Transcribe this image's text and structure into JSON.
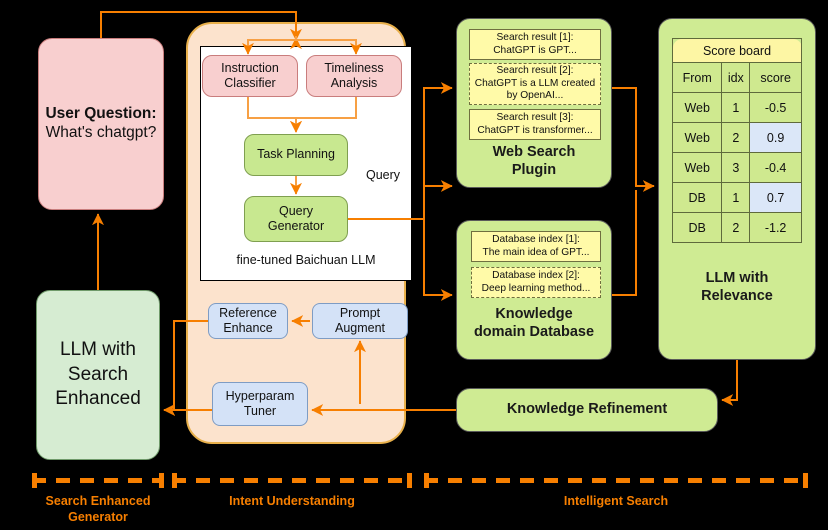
{
  "diagram": {
    "title": "Search Enhanced LLM pipeline",
    "colors": {
      "arrow": "#f77f00",
      "panel_orange_fill": "#fce3cd",
      "panel_orange_border": "#e8b04b",
      "green_fill": "#cfeb93",
      "pink_fill": "#f8cfcf",
      "lime_fill": "#c8e890",
      "blue_fill": "#d4e2f7",
      "card_yellow": "#fffaa8",
      "highlight_blue": "#dbe7f8",
      "legend_orange": "#f77f00"
    }
  },
  "user_question": {
    "label": "User Question:",
    "text": "What's chatgpt?"
  },
  "intent_panel": {
    "inner_label": "fine-tuned Baichuan LLM",
    "query_label": "Query",
    "boxes": {
      "instruction_classifier": "Instruction\nClassifier",
      "instruction_classifier_l1": "Instruction",
      "instruction_classifier_l2": "Classifier",
      "timeliness_l1": "Timeliness",
      "timeliness_l2": "Analysis",
      "task_planning": "Task Planning",
      "query_generator_l1": "Query",
      "query_generator_l2": "Generator",
      "reference_enhance_l1": "Reference",
      "reference_enhance_l2": "Enhance",
      "prompt_augment_l1": "Prompt",
      "prompt_augment_l2": "Augment",
      "hyperparam_tuner_l1": "Hyperparam",
      "hyperparam_tuner_l2": "Tuner"
    }
  },
  "web_search_plugin": {
    "caption_l1": "Web Search",
    "caption_l2": "Plugin",
    "results": [
      {
        "title": "Search result [1]:",
        "body": "ChatGPT is GPT...",
        "style": "solid"
      },
      {
        "title": "Search result [2]:",
        "body": "ChatGPT is a LLM created by OpenAI...",
        "style": "dashed"
      },
      {
        "title": "Search result [3]:",
        "body": "ChatGPT is transformer...",
        "style": "solid"
      }
    ]
  },
  "knowledge_database": {
    "caption_l1": "Knowledge",
    "caption_l2": "domain Database",
    "entries": [
      {
        "title": "Database index [1]:",
        "body": "The main idea of GPT...",
        "style": "solid"
      },
      {
        "title": "Database index [2]:",
        "body": "Deep learning method...",
        "style": "dashed"
      }
    ]
  },
  "relevance_panel": {
    "caption_l1": "LLM with",
    "caption_l2": "Relevance",
    "scoreboard": {
      "title": "Score board",
      "columns": [
        "From",
        "idx",
        "score"
      ],
      "rows": [
        {
          "from": "Web",
          "idx": "1",
          "score": "-0.5",
          "highlight": false
        },
        {
          "from": "Web",
          "idx": "2",
          "score": "0.9",
          "highlight": true
        },
        {
          "from": "Web",
          "idx": "3",
          "score": "-0.4",
          "highlight": false
        },
        {
          "from": "DB",
          "idx": "1",
          "score": "0.7",
          "highlight": true
        },
        {
          "from": "DB",
          "idx": "2",
          "score": "-1.2",
          "highlight": false
        }
      ]
    }
  },
  "knowledge_refinement": {
    "label": "Knowledge Refinement"
  },
  "search_enhanced_generator": {
    "l1": "LLM with",
    "l2": "Search",
    "l3": "Enhanced"
  },
  "legend": [
    {
      "l1": "Search Enhanced",
      "l2": "Generator"
    },
    {
      "l1": "Intent Understanding",
      "l2": ""
    },
    {
      "l1": "Intelligent Search",
      "l2": ""
    }
  ]
}
